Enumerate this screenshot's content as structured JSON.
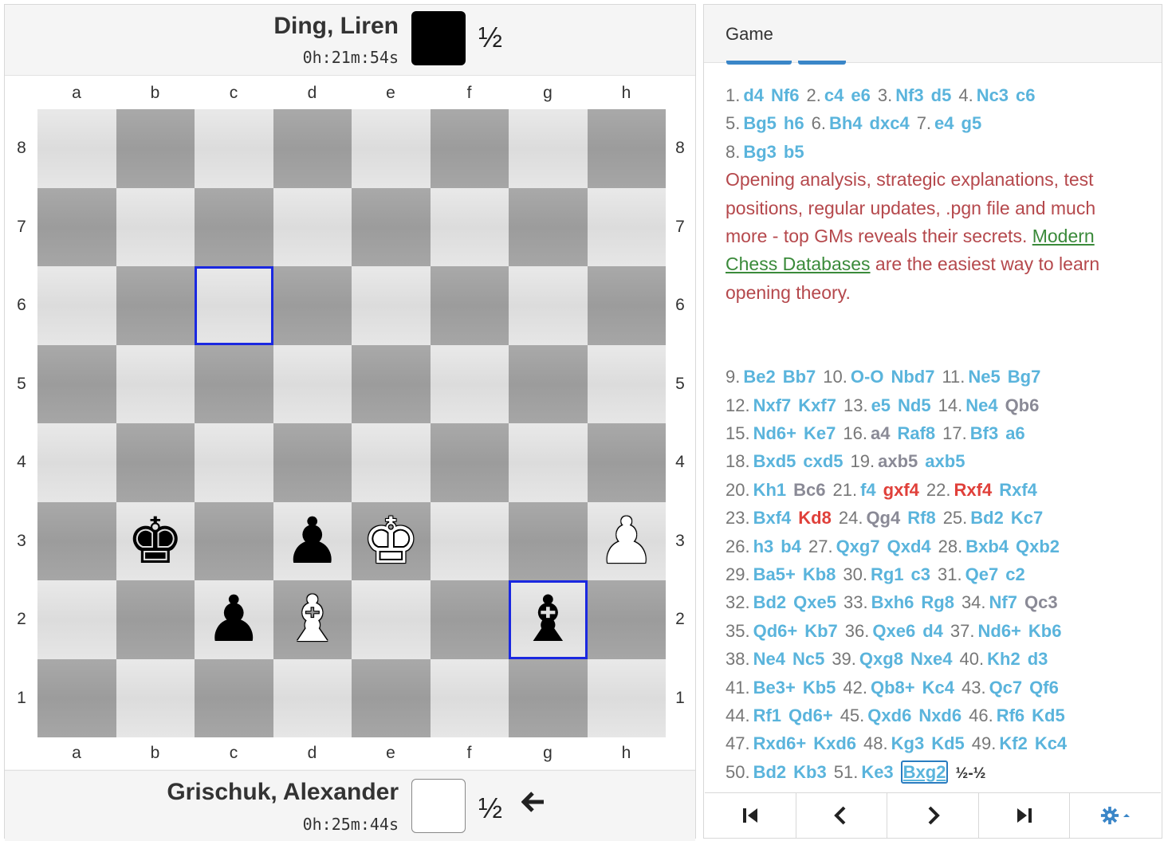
{
  "players": {
    "black": {
      "name": "Ding, Liren",
      "clock": "0h:21m:54s",
      "score": "½",
      "color": "#000000"
    },
    "white": {
      "name": "Grischuk, Alexander",
      "clock": "0h:25m:44s",
      "score": "½",
      "color": "#ffffff"
    }
  },
  "board": {
    "files": [
      "a",
      "b",
      "c",
      "d",
      "e",
      "f",
      "g",
      "h"
    ],
    "ranks": [
      "8",
      "7",
      "6",
      "5",
      "4",
      "3",
      "2",
      "1"
    ],
    "highlight_color": "#1a28e0",
    "highlighted_squares": [
      "c6",
      "g2"
    ],
    "pieces": [
      {
        "square": "b3",
        "piece": "king",
        "color": "black",
        "glyph": "♚"
      },
      {
        "square": "d3",
        "piece": "pawn",
        "color": "black",
        "glyph": "♟"
      },
      {
        "square": "e3",
        "piece": "king",
        "color": "white",
        "glyph": "♚"
      },
      {
        "square": "h3",
        "piece": "pawn",
        "color": "white",
        "glyph": "♟"
      },
      {
        "square": "c2",
        "piece": "pawn",
        "color": "black",
        "glyph": "♟"
      },
      {
        "square": "d2",
        "piece": "bishop",
        "color": "white",
        "glyph": "♝"
      },
      {
        "square": "g2",
        "piece": "bishop",
        "color": "black",
        "glyph": "♝"
      }
    ]
  },
  "panel": {
    "title": "Game"
  },
  "move_colors": {
    "move": "#5ab4dc",
    "gray": "#8a8a96",
    "red": "#e0403a",
    "comment": "#b5484c",
    "link": "#3a8a3a"
  },
  "moves_part1": [
    [
      {
        "n": "1."
      },
      {
        "m": "d4"
      },
      {
        "m": "Nf6"
      },
      {
        "n": "2."
      },
      {
        "m": "c4"
      },
      {
        "m": "e6"
      },
      {
        "n": "3."
      },
      {
        "m": "Nf3"
      },
      {
        "m": "d5"
      },
      {
        "n": "4."
      },
      {
        "m": "Nc3"
      },
      {
        "m": "c6"
      }
    ],
    [
      {
        "n": "5."
      },
      {
        "m": "Bg5"
      },
      {
        "m": "h6"
      },
      {
        "n": "6."
      },
      {
        "m": "Bh4"
      },
      {
        "m": "dxc4"
      },
      {
        "n": "7."
      },
      {
        "m": "e4"
      },
      {
        "m": "g5"
      }
    ],
    [
      {
        "n": "8."
      },
      {
        "m": "Bg3"
      },
      {
        "m": "b5"
      }
    ]
  ],
  "comment": {
    "text": "Opening analysis, strategic explanations, test positions, regular updates, .pgn file and much more - top GMs reveals their secrets. ",
    "link": "Modern Chess Databases",
    "tail": " are the easiest way to learn opening theory."
  },
  "moves_part2": [
    [
      {
        "n": "9."
      },
      {
        "m": "Be2"
      },
      {
        "m": "Bb7"
      },
      {
        "n": "10."
      },
      {
        "m": "O-O"
      },
      {
        "m": "Nbd7"
      },
      {
        "n": "11."
      },
      {
        "m": "Ne5"
      },
      {
        "m": "Bg7"
      }
    ],
    [
      {
        "n": "12."
      },
      {
        "m": "Nxf7"
      },
      {
        "m": "Kxf7"
      },
      {
        "n": "13."
      },
      {
        "m": "e5"
      },
      {
        "m": "Nd5"
      },
      {
        "n": "14."
      },
      {
        "m": "Ne4"
      },
      {
        "m": "Qb6",
        "c": "gray"
      }
    ],
    [
      {
        "n": "15."
      },
      {
        "m": "Nd6+"
      },
      {
        "m": "Ke7"
      },
      {
        "n": "16."
      },
      {
        "m": "a4",
        "c": "gray"
      },
      {
        "m": "Raf8"
      },
      {
        "n": "17."
      },
      {
        "m": "Bf3"
      },
      {
        "m": "a6"
      }
    ],
    [
      {
        "n": "18."
      },
      {
        "m": "Bxd5"
      },
      {
        "m": "cxd5"
      },
      {
        "n": "19."
      },
      {
        "m": "axb5",
        "c": "gray"
      },
      {
        "m": "axb5"
      }
    ],
    [
      {
        "n": "20."
      },
      {
        "m": "Kh1"
      },
      {
        "m": "Bc6",
        "c": "gray"
      },
      {
        "n": "21."
      },
      {
        "m": "f4"
      },
      {
        "m": "gxf4",
        "c": "red"
      },
      {
        "n": "22."
      },
      {
        "m": "Rxf4",
        "c": "red"
      },
      {
        "m": "Rxf4"
      }
    ],
    [
      {
        "n": "23."
      },
      {
        "m": "Bxf4"
      },
      {
        "m": "Kd8",
        "c": "red"
      },
      {
        "n": "24."
      },
      {
        "m": "Qg4",
        "c": "gray"
      },
      {
        "m": "Rf8"
      },
      {
        "n": "25."
      },
      {
        "m": "Bd2"
      },
      {
        "m": "Kc7"
      }
    ],
    [
      {
        "n": "26."
      },
      {
        "m": "h3"
      },
      {
        "m": "b4"
      },
      {
        "n": "27."
      },
      {
        "m": "Qxg7"
      },
      {
        "m": "Qxd4"
      },
      {
        "n": "28."
      },
      {
        "m": "Bxb4"
      },
      {
        "m": "Qxb2"
      }
    ],
    [
      {
        "n": "29."
      },
      {
        "m": "Ba5+"
      },
      {
        "m": "Kb8"
      },
      {
        "n": "30."
      },
      {
        "m": "Rg1"
      },
      {
        "m": "c3"
      },
      {
        "n": "31."
      },
      {
        "m": "Qe7"
      },
      {
        "m": "c2"
      }
    ],
    [
      {
        "n": "32."
      },
      {
        "m": "Bd2"
      },
      {
        "m": "Qxe5"
      },
      {
        "n": "33."
      },
      {
        "m": "Bxh6"
      },
      {
        "m": "Rg8"
      },
      {
        "n": "34."
      },
      {
        "m": "Nf7"
      },
      {
        "m": "Qc3",
        "c": "gray"
      }
    ],
    [
      {
        "n": "35."
      },
      {
        "m": "Qd6+"
      },
      {
        "m": "Kb7"
      },
      {
        "n": "36."
      },
      {
        "m": "Qxe6"
      },
      {
        "m": "d4"
      },
      {
        "n": "37."
      },
      {
        "m": "Nd6+"
      },
      {
        "m": "Kb6"
      }
    ],
    [
      {
        "n": "38."
      },
      {
        "m": "Ne4"
      },
      {
        "m": "Nc5"
      },
      {
        "n": "39."
      },
      {
        "m": "Qxg8"
      },
      {
        "m": "Nxe4"
      },
      {
        "n": "40."
      },
      {
        "m": "Kh2"
      },
      {
        "m": "d3"
      }
    ],
    [
      {
        "n": "41."
      },
      {
        "m": "Be3+"
      },
      {
        "m": "Kb5"
      },
      {
        "n": "42."
      },
      {
        "m": "Qb8+"
      },
      {
        "m": "Kc4"
      },
      {
        "n": "43."
      },
      {
        "m": "Qc7"
      },
      {
        "m": "Qf6"
      }
    ],
    [
      {
        "n": "44."
      },
      {
        "m": "Rf1"
      },
      {
        "m": "Qd6+"
      },
      {
        "n": "45."
      },
      {
        "m": "Qxd6"
      },
      {
        "m": "Nxd6"
      },
      {
        "n": "46."
      },
      {
        "m": "Rf6"
      },
      {
        "m": "Kd5"
      }
    ],
    [
      {
        "n": "47."
      },
      {
        "m": "Rxd6+"
      },
      {
        "m": "Kxd6"
      },
      {
        "n": "48."
      },
      {
        "m": "Kg3"
      },
      {
        "m": "Kd5"
      },
      {
        "n": "49."
      },
      {
        "m": "Kf2"
      },
      {
        "m": "Kc4"
      }
    ],
    [
      {
        "n": "50."
      },
      {
        "m": "Bd2"
      },
      {
        "m": "Kb3"
      },
      {
        "n": "51."
      },
      {
        "m": "Ke3"
      },
      {
        "m": "Bxg2",
        "c": "cur"
      },
      {
        "r": "½-½"
      }
    ]
  ],
  "nav": [
    {
      "name": "first-move-button",
      "icon": "skip-back-icon"
    },
    {
      "name": "previous-move-button",
      "icon": "chevron-left-icon"
    },
    {
      "name": "next-move-button",
      "icon": "chevron-right-icon"
    },
    {
      "name": "last-move-button",
      "icon": "skip-forward-icon"
    },
    {
      "name": "settings-button",
      "icon": "gear-icon"
    }
  ]
}
